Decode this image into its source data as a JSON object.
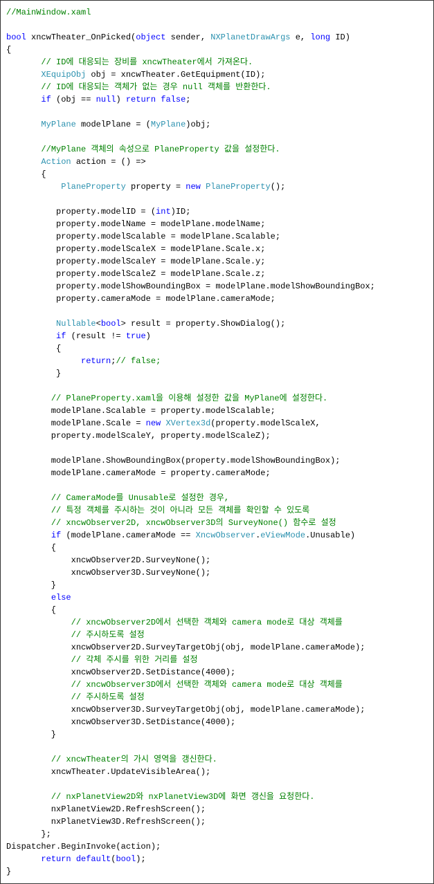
{
  "lines": [
    {
      "segments": [
        {
          "cls": "c-comment",
          "text": "//MainWindow.xaml"
        }
      ]
    },
    {
      "segments": []
    },
    {
      "segments": [
        {
          "cls": "c-keyword",
          "text": "bool"
        },
        {
          "cls": "c-text",
          "text": " xncwTheater_OnPicked("
        },
        {
          "cls": "c-keyword",
          "text": "object"
        },
        {
          "cls": "c-text",
          "text": " sender, "
        },
        {
          "cls": "c-type",
          "text": "NXPlanetDrawArgs"
        },
        {
          "cls": "c-text",
          "text": " e, "
        },
        {
          "cls": "c-keyword",
          "text": "long"
        },
        {
          "cls": "c-text",
          "text": " ID)"
        }
      ]
    },
    {
      "segments": [
        {
          "cls": "c-text",
          "text": "{"
        }
      ]
    },
    {
      "segments": [
        {
          "cls": "c-text",
          "text": "       "
        },
        {
          "cls": "c-comment",
          "text": "// ID에 대응되는 장비를 xncwTheater에서 가져온다."
        }
      ]
    },
    {
      "segments": [
        {
          "cls": "c-text",
          "text": "       "
        },
        {
          "cls": "c-type",
          "text": "XEquipObj"
        },
        {
          "cls": "c-text",
          "text": " obj = xncwTheater.GetEquipment(ID);"
        }
      ]
    },
    {
      "segments": [
        {
          "cls": "c-text",
          "text": "       "
        },
        {
          "cls": "c-comment",
          "text": "// ID에 대응되는 객체가 없는 경우 null 객체를 반환한다."
        }
      ]
    },
    {
      "segments": [
        {
          "cls": "c-text",
          "text": "       "
        },
        {
          "cls": "c-keyword",
          "text": "if"
        },
        {
          "cls": "c-text",
          "text": " (obj == "
        },
        {
          "cls": "c-keyword",
          "text": "null"
        },
        {
          "cls": "c-text",
          "text": ") "
        },
        {
          "cls": "c-keyword",
          "text": "return false"
        },
        {
          "cls": "c-text",
          "text": ";"
        }
      ]
    },
    {
      "segments": []
    },
    {
      "segments": [
        {
          "cls": "c-text",
          "text": "       "
        },
        {
          "cls": "c-type",
          "text": "MyPlane"
        },
        {
          "cls": "c-text",
          "text": " modelPlane = ("
        },
        {
          "cls": "c-type",
          "text": "MyPlane"
        },
        {
          "cls": "c-text",
          "text": ")obj;"
        }
      ]
    },
    {
      "segments": []
    },
    {
      "segments": [
        {
          "cls": "c-text",
          "text": "       "
        },
        {
          "cls": "c-comment",
          "text": "//MyPlane 객체의 속성으로 PlaneProperty 값을 설정한다."
        }
      ]
    },
    {
      "segments": [
        {
          "cls": "c-text",
          "text": "       "
        },
        {
          "cls": "c-type",
          "text": "Action"
        },
        {
          "cls": "c-text",
          "text": " action = () =>"
        }
      ]
    },
    {
      "segments": [
        {
          "cls": "c-text",
          "text": "       {"
        }
      ]
    },
    {
      "segments": [
        {
          "cls": "c-text",
          "text": "           "
        },
        {
          "cls": "c-type",
          "text": "PlaneProperty"
        },
        {
          "cls": "c-text",
          "text": " property = "
        },
        {
          "cls": "c-keyword",
          "text": "new"
        },
        {
          "cls": "c-text",
          "text": " "
        },
        {
          "cls": "c-type",
          "text": "PlaneProperty"
        },
        {
          "cls": "c-text",
          "text": "();"
        }
      ]
    },
    {
      "segments": []
    },
    {
      "segments": [
        {
          "cls": "c-text",
          "text": "          property.modelID = ("
        },
        {
          "cls": "c-keyword",
          "text": "int"
        },
        {
          "cls": "c-text",
          "text": ")ID;"
        }
      ]
    },
    {
      "segments": [
        {
          "cls": "c-text",
          "text": "          property.modelName = modelPlane.modelName;"
        }
      ]
    },
    {
      "segments": [
        {
          "cls": "c-text",
          "text": "          property.modelScalable = modelPlane.Scalable;"
        }
      ]
    },
    {
      "segments": [
        {
          "cls": "c-text",
          "text": "          property.modelScaleX = modelPlane.Scale.x;"
        }
      ]
    },
    {
      "segments": [
        {
          "cls": "c-text",
          "text": "          property.modelScaleY = modelPlane.Scale.y;"
        }
      ]
    },
    {
      "segments": [
        {
          "cls": "c-text",
          "text": "          property.modelScaleZ = modelPlane.Scale.z;"
        }
      ]
    },
    {
      "segments": [
        {
          "cls": "c-text",
          "text": "          property.modelShowBoundingBox = modelPlane.modelShowBoundingBox;"
        }
      ]
    },
    {
      "segments": [
        {
          "cls": "c-text",
          "text": "          property.cameraMode = modelPlane.cameraMode;"
        }
      ]
    },
    {
      "segments": []
    },
    {
      "segments": [
        {
          "cls": "c-text",
          "text": "          "
        },
        {
          "cls": "c-type",
          "text": "Nullable"
        },
        {
          "cls": "c-text",
          "text": "<"
        },
        {
          "cls": "c-keyword",
          "text": "bool"
        },
        {
          "cls": "c-text",
          "text": "> result = property.ShowDialog();"
        }
      ]
    },
    {
      "segments": [
        {
          "cls": "c-text",
          "text": "          "
        },
        {
          "cls": "c-keyword",
          "text": "if"
        },
        {
          "cls": "c-text",
          "text": " (result != "
        },
        {
          "cls": "c-keyword",
          "text": "true"
        },
        {
          "cls": "c-text",
          "text": ")"
        }
      ]
    },
    {
      "segments": [
        {
          "cls": "c-text",
          "text": "          {"
        }
      ]
    },
    {
      "segments": [
        {
          "cls": "c-text",
          "text": "               "
        },
        {
          "cls": "c-keyword",
          "text": "return"
        },
        {
          "cls": "c-text",
          "text": ";"
        },
        {
          "cls": "c-comment",
          "text": "// false;"
        }
      ]
    },
    {
      "segments": [
        {
          "cls": "c-text",
          "text": "          }"
        }
      ]
    },
    {
      "segments": []
    },
    {
      "segments": [
        {
          "cls": "c-text",
          "text": "         "
        },
        {
          "cls": "c-comment",
          "text": "// PlaneProperty.xaml을 이용해 설정한 값을 MyPlane에 설정한다."
        }
      ]
    },
    {
      "segments": [
        {
          "cls": "c-text",
          "text": "         modelPlane.Scalable = property.modelScalable;"
        }
      ]
    },
    {
      "segments": [
        {
          "cls": "c-text",
          "text": "         modelPlane.Scale = "
        },
        {
          "cls": "c-keyword",
          "text": "new"
        },
        {
          "cls": "c-text",
          "text": " "
        },
        {
          "cls": "c-type",
          "text": "XVertex3d"
        },
        {
          "cls": "c-text",
          "text": "(property.modelScaleX,"
        }
      ]
    },
    {
      "segments": [
        {
          "cls": "c-text",
          "text": "         property.modelScaleY, property.modelScaleZ);"
        }
      ]
    },
    {
      "segments": []
    },
    {
      "segments": [
        {
          "cls": "c-text",
          "text": "         modelPlane.ShowBoundingBox(property.modelShowBoundingBox);"
        }
      ]
    },
    {
      "segments": [
        {
          "cls": "c-text",
          "text": "         modelPlane.cameraMode = property.cameraMode;"
        }
      ]
    },
    {
      "segments": []
    },
    {
      "segments": [
        {
          "cls": "c-text",
          "text": "         "
        },
        {
          "cls": "c-comment",
          "text": "// CameraMode를 Unusable로 설정한 경우,"
        }
      ]
    },
    {
      "segments": [
        {
          "cls": "c-text",
          "text": "         "
        },
        {
          "cls": "c-comment",
          "text": "// 특정 객체를 주시하는 것이 아니라 모든 객체를 확인할 수 있도록"
        }
      ]
    },
    {
      "segments": [
        {
          "cls": "c-text",
          "text": "         "
        },
        {
          "cls": "c-comment",
          "text": "// xncwObserver2D, xncwObserver3D의 SurveyNone() 함수로 설정"
        }
      ]
    },
    {
      "segments": [
        {
          "cls": "c-text",
          "text": "         "
        },
        {
          "cls": "c-keyword",
          "text": "if"
        },
        {
          "cls": "c-text",
          "text": " (modelPlane.cameraMode == "
        },
        {
          "cls": "c-type",
          "text": "XncwObserver"
        },
        {
          "cls": "c-text",
          "text": "."
        },
        {
          "cls": "c-type",
          "text": "eViewMode"
        },
        {
          "cls": "c-text",
          "text": ".Unusable)"
        }
      ]
    },
    {
      "segments": [
        {
          "cls": "c-text",
          "text": "         {"
        }
      ]
    },
    {
      "segments": [
        {
          "cls": "c-text",
          "text": "             xncwObserver2D.SurveyNone();"
        }
      ]
    },
    {
      "segments": [
        {
          "cls": "c-text",
          "text": "             xncwObserver3D.SurveyNone();"
        }
      ]
    },
    {
      "segments": [
        {
          "cls": "c-text",
          "text": "         }"
        }
      ]
    },
    {
      "segments": [
        {
          "cls": "c-text",
          "text": "         "
        },
        {
          "cls": "c-keyword",
          "text": "else"
        }
      ]
    },
    {
      "segments": [
        {
          "cls": "c-text",
          "text": "         {"
        }
      ]
    },
    {
      "segments": [
        {
          "cls": "c-text",
          "text": "             "
        },
        {
          "cls": "c-comment",
          "text": "// xncwObserver2D에서 선택한 객체와 camera mode로 대상 객체를"
        }
      ]
    },
    {
      "segments": [
        {
          "cls": "c-text",
          "text": "             "
        },
        {
          "cls": "c-comment",
          "text": "// 주시하도록 설정"
        }
      ]
    },
    {
      "segments": [
        {
          "cls": "c-text",
          "text": "             xncwObserver2D.SurveyTargetObj(obj, modelPlane.cameraMode);"
        }
      ]
    },
    {
      "segments": [
        {
          "cls": "c-text",
          "text": "             "
        },
        {
          "cls": "c-comment",
          "text": "// 각체 주시를 위한 거리를 설정"
        }
      ]
    },
    {
      "segments": [
        {
          "cls": "c-text",
          "text": "             xncwObserver2D.SetDistance(4000);"
        }
      ]
    },
    {
      "segments": [
        {
          "cls": "c-text",
          "text": "             "
        },
        {
          "cls": "c-comment",
          "text": "// xncwObserver3D에서 선택한 객체와 camera mode로 대상 객체를"
        }
      ]
    },
    {
      "segments": [
        {
          "cls": "c-text",
          "text": "             "
        },
        {
          "cls": "c-comment",
          "text": "// 주시하도록 설정"
        }
      ]
    },
    {
      "segments": [
        {
          "cls": "c-text",
          "text": "             xncwObserver3D.SurveyTargetObj(obj, modelPlane.cameraMode);"
        }
      ]
    },
    {
      "segments": [
        {
          "cls": "c-text",
          "text": "             xncwObserver3D.SetDistance(4000);"
        }
      ]
    },
    {
      "segments": [
        {
          "cls": "c-text",
          "text": "         }"
        }
      ]
    },
    {
      "segments": []
    },
    {
      "segments": [
        {
          "cls": "c-text",
          "text": "         "
        },
        {
          "cls": "c-comment",
          "text": "// xncwTheater의 가시 영역을 갱신한다."
        }
      ]
    },
    {
      "segments": [
        {
          "cls": "c-text",
          "text": "         xncwTheater.UpdateVisibleArea();"
        }
      ]
    },
    {
      "segments": []
    },
    {
      "segments": [
        {
          "cls": "c-text",
          "text": "         "
        },
        {
          "cls": "c-comment",
          "text": "// nxPlanetView2D와 nxPlanetView3D에 화면 갱신을 요청한다."
        }
      ]
    },
    {
      "segments": [
        {
          "cls": "c-text",
          "text": "         nxPlanetView2D.RefreshScreen();"
        }
      ]
    },
    {
      "segments": [
        {
          "cls": "c-text",
          "text": "         nxPlanetView3D.RefreshScreen();"
        }
      ]
    },
    {
      "segments": [
        {
          "cls": "c-text",
          "text": "       };"
        }
      ]
    },
    {
      "segments": [
        {
          "cls": "c-text",
          "text": "Dispatcher.BeginInvoke(action);"
        }
      ]
    },
    {
      "segments": [
        {
          "cls": "c-text",
          "text": "       "
        },
        {
          "cls": "c-keyword",
          "text": "return default"
        },
        {
          "cls": "c-text",
          "text": "("
        },
        {
          "cls": "c-keyword",
          "text": "bool"
        },
        {
          "cls": "c-text",
          "text": ");"
        }
      ]
    },
    {
      "segments": [
        {
          "cls": "c-text",
          "text": "}"
        }
      ]
    }
  ]
}
